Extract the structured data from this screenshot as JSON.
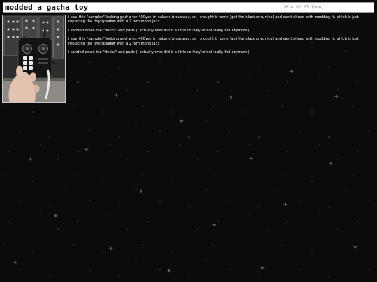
{
  "post": {
    "title": "modded a gacha toy",
    "date": "2024.02.23 [mon]",
    "photo": {
      "subject": "hand-holding-black-mini-sampler-toy-in-front-of-synth-rack"
    },
    "paragraphs": [
      "i saw this \"sampler\" looking gacha for 400yen in nakano broadway, so i brought it home (got the black one, nice) and went ahead with modding it, which is just replacing the tiny speaker with a 2.mm mono jack",
      "i sanded down the \"decks\" and pads (i actually over did it a little so they're not really flat anymore)",
      "i saw this \"sampler\" looking gacha for 400yen in nakano broadway, so i brought it home (got the black one, nice) and went ahead with modding it, which is just replacing the tiny speaker with a 2.mm mono jack",
      "i sanded down the \"decks\" and pads (i actually over did it a little so they're not really flat anymore)"
    ]
  },
  "background": {
    "color": "#0b0b0b",
    "star_color": "#ffffff",
    "pattern": "sparkle-starfield"
  }
}
